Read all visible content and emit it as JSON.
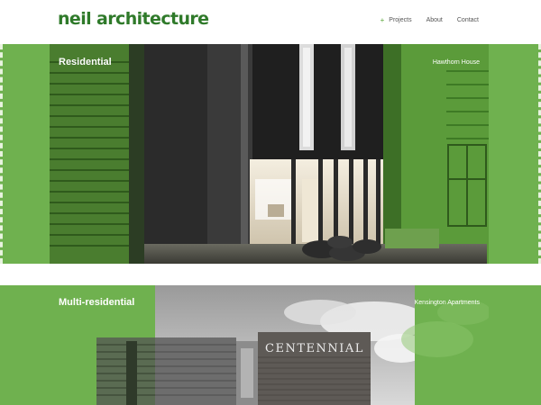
{
  "header": {
    "logo": "neil architecture",
    "nav": [
      {
        "label": "Projects",
        "active": true
      },
      {
        "label": "About"
      },
      {
        "label": "Contact"
      }
    ]
  },
  "projects": [
    {
      "category": "Residential",
      "name": "Hawthorn House"
    },
    {
      "category": "Multi-residential",
      "name": "Kensington Apartments",
      "sign": "CENTENNIAL"
    }
  ],
  "colors": {
    "brand_green": "#2f7a2a",
    "band_green": "#6fb14f",
    "nav_text": "#555555"
  }
}
